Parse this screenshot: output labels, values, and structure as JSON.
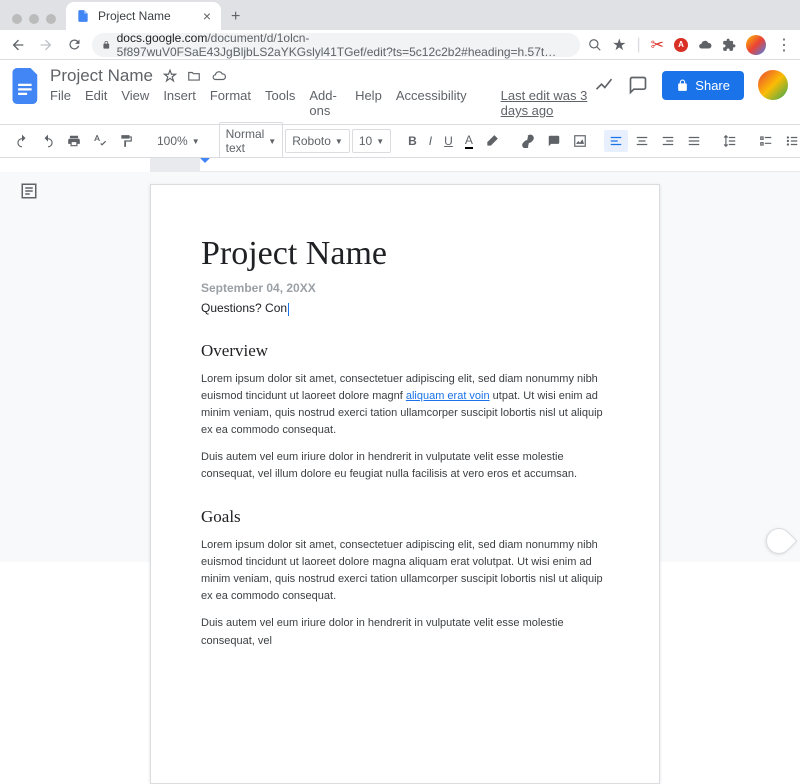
{
  "browser": {
    "tab_title": "Project Name",
    "url_host": "docs.google.com",
    "url_path": "/document/d/1olcn-5f897wuV0FSaE43JgBljbLS2aYKGslyl41TGef/edit?ts=5c12c2b2#heading=h.57t…"
  },
  "docs": {
    "title": "Project Name",
    "menubar": [
      "File",
      "Edit",
      "View",
      "Insert",
      "Format",
      "Tools",
      "Add-ons",
      "Help",
      "Accessibility"
    ],
    "last_edit": "Last edit was 3 days ago",
    "share_label": "Share"
  },
  "toolbar": {
    "zoom": "100%",
    "style": "Normal text",
    "font": "Roboto",
    "size": "10"
  },
  "document": {
    "h1": "Project Name",
    "date": "September 04, 20XX",
    "questions_prefix": "Questions? Con",
    "overview_h": "Overview",
    "overview_p1a": "Lorem ipsum dolor sit amet, consectetuer adipiscing elit, sed diam nonummy nibh euismod tincidunt ut laoreet dolore magnf ",
    "overview_link": "aliquam erat voin",
    "overview_p1b": " utpat. Ut wisi enim ad minim veniam, quis nostrud exerci tation ullamcorper suscipit lobortis nisl ut aliquip ex ea commodo consequat.",
    "overview_p2": "Duis autem vel eum iriure dolor in hendrerit in vulputate velit esse molestie consequat, vel illum dolore eu feugiat nulla facilisis at vero eros et accumsan.",
    "goals_h": "Goals",
    "goals_p1": "Lorem ipsum dolor sit amet, consectetuer adipiscing elit, sed diam nonummy nibh euismod tincidunt ut laoreet dolore magna aliquam erat volutpat. Ut wisi enim ad minim veniam, quis nostrud exerci tation ullamcorper suscipit lobortis nisl ut aliquip ex ea commodo consequat.",
    "goals_p2": "Duis autem vel eum iriure dolor in hendrerit in vulputate velit esse molestie consequat, vel"
  }
}
